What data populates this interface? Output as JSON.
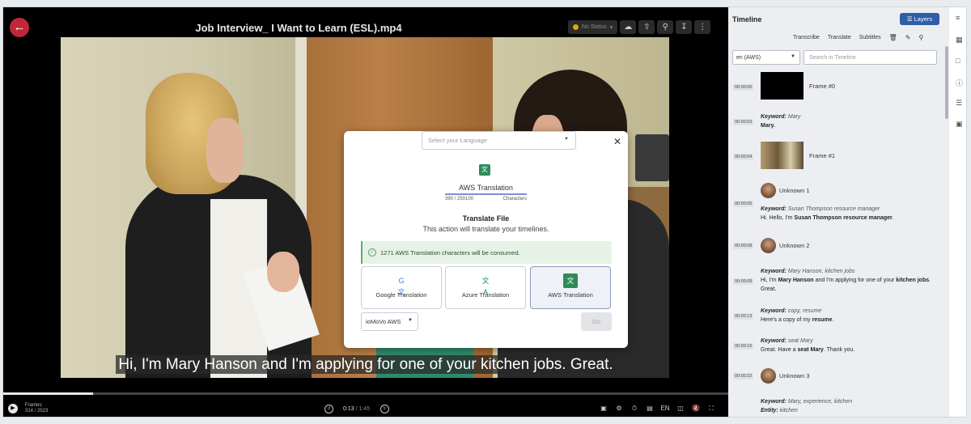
{
  "player": {
    "title": "Job Interview_ I Want to Learn (ESL).mp4",
    "status_label": "No Status",
    "subtitle": "Hi, I'm Mary Hanson and I'm applying for one of your kitchen jobs. Great.",
    "frames_label": "Frames:",
    "frames_value": "314 / 2523",
    "time_current": "0:13",
    "time_separator": " / ",
    "time_total": "1:45",
    "progress_fraction": 0.124,
    "lang_code": "EN"
  },
  "modal": {
    "service_name": "AWS Translation",
    "char_count": "390 / 250100",
    "char_label": "Characters",
    "heading": "Translate File",
    "subheading": "This action will translate your timelines.",
    "alert_text": "1271 AWS Translation characters will be consumed.",
    "providers": [
      {
        "label": "Google Translation",
        "icon": "google-translate-icon"
      },
      {
        "label": "Azure Translation",
        "icon": "azure-translate-icon"
      },
      {
        "label": "AWS Translation",
        "icon": "aws-translate-icon"
      }
    ],
    "engine_value": "ioMoVo AWS",
    "language_placeholder": "Select your Language",
    "go_label": "Go"
  },
  "timeline": {
    "title": "Timeline",
    "layers_label": "Layers",
    "tabs": [
      "Transcribe",
      "Translate",
      "Subtitles"
    ],
    "language_value": "en (AWS)",
    "search_placeholder": "Search in Timeline",
    "entries": [
      {
        "ts": "00:00:00",
        "frame": "Frame #0"
      },
      {
        "ts": "00:00:03",
        "kw_label": "Keyword:",
        "kw_value": "Mary",
        "text": "Mary."
      },
      {
        "ts": "00:00:04",
        "frame": "Frame #1"
      },
      {
        "ts": "00:00:05",
        "speaker": "Unknown 1",
        "kw_label": "Keyword:",
        "kw_value": "Susan Thompson resource manager",
        "text_pre": "Hi. Hello, I'm ",
        "text_bold": "Susan Thompson resource manager",
        "text_post": "."
      },
      {
        "ts": "00:00:08",
        "speaker": "Unknown 2"
      },
      {
        "ts": "00:00:09",
        "kw_label": "Keyword:",
        "kw_value": "Mary Hanson, kitchen jobs",
        "text_pre": "Hi, I'm ",
        "text_bold": "Mary Hanson",
        "text_mid": " and I'm applying for one of your ",
        "text_bold2": "kitchen jobs",
        "text_post": ". Great."
      },
      {
        "ts": "00:00:13",
        "kw_label": "Keyword:",
        "kw_value": "copy, resume",
        "text_pre": "Here's a copy of my ",
        "text_bold": "resume",
        "text_post": "."
      },
      {
        "ts": "00:00:15",
        "kw_label": "Keyword:",
        "kw_value": "seat Mary",
        "text_pre": "Great. Have a ",
        "text_bold": "seat Mary",
        "text_post": ". Thank you."
      },
      {
        "ts": "00:00:22",
        "speaker": "Unknown 3"
      },
      {
        "kw_label": "Keyword:",
        "kw_value": "Mary, experience, kitchen",
        "entity_label": "Entity:",
        "entity_value": "kitchen"
      }
    ]
  }
}
